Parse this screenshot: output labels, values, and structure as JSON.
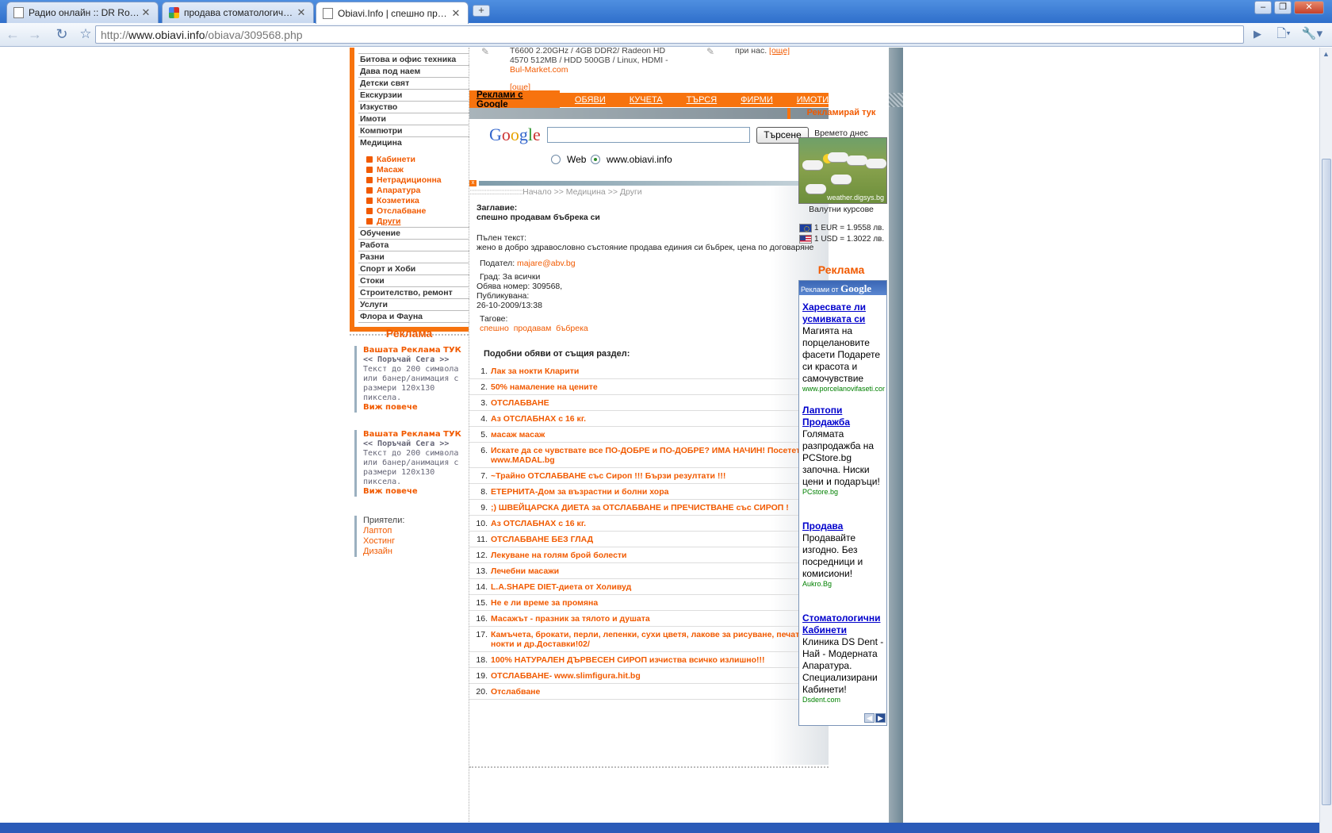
{
  "browser": {
    "tabs": [
      {
        "title": "Радио онлайн :: DR Rock ...",
        "icon": "page-icon",
        "active": false
      },
      {
        "title": "продава стоматологичен ...",
        "icon": "google-icon",
        "active": false
      },
      {
        "title": "Obiavi.Info | спешно прод...",
        "icon": "page-icon",
        "active": true
      }
    ],
    "new_tab_glyph": "+",
    "url_prefix": "http://",
    "url_host": "www.obiavi.info",
    "url_path": "/obiava/309568.php"
  },
  "top_products": {
    "item_text": "T6600 2.20GHz / 4GB DDR2/ Radeon HD 4570 512MB / HDD 500GB / Linux, HDMI - ",
    "item_link": "Bul-Market.com",
    "item_more": "[още]",
    "right_text": "при нас.",
    "right_more": "[още]"
  },
  "sidebar": {
    "categories_top": [
      "Битова и офис техника",
      "Дава под наем",
      "Детски свят",
      "Екскурзии",
      "Изкуство",
      "Имоти",
      "Компютри",
      "Медицина"
    ],
    "subcategories": [
      "Кабинети",
      "Масаж",
      "Нетрадиционна",
      "Апаратура",
      "Козметика",
      "Отслабване",
      "Други"
    ],
    "categories_bottom": [
      "Обучение",
      "Работа",
      "Разни",
      "Спорт и Хоби",
      "Стоки",
      "Строителство, ремонт",
      "Услуги",
      "Флора и Фауна"
    ],
    "promo_heading": "Реклама",
    "promos": [
      {
        "title": "Вашата Реклама ТУК",
        "order": "<< Поръчай Сега >>",
        "body": "Текст до 200 символа или банер/анимация с размери 120x130 пиксела.",
        "more": "Виж повече"
      },
      {
        "title": "Вашата Реклама ТУК",
        "order": "<< Поръчай Сега >>",
        "body": "Текст до 200 символа или банер/анимация с размери 120x130 пиксела.",
        "more": "Виж повече"
      }
    ],
    "friends_label": "Приятели:",
    "friends": [
      "Лаптоп",
      "Хостинг",
      "Дизайн"
    ]
  },
  "menu": {
    "brand": "Реклами с Google",
    "items": [
      "ОБЯВИ",
      "КУЧЕТА",
      "ТЪРСЯ",
      "ФИРМИ",
      "ИМОТИ"
    ]
  },
  "search": {
    "logo": "Google",
    "button": "Търсене",
    "query": "",
    "options": [
      {
        "label": "Web",
        "checked": false
      },
      {
        "label": "www.obiavi.info",
        "checked": true
      }
    ]
  },
  "breadcrumb": {
    "dots": ":::::::::::::::::::::::::::::::::::",
    "text": "Начало >> Медицина >> Други"
  },
  "ad": {
    "title_label": "Заглавие:",
    "title": "спешно продавам бъбрека си",
    "fulltext_label": "Пълен текст:",
    "fulltext": "жено в добро здравословно състояние продава единия си бъбрек, цена по договаряне",
    "poster_label": "Подател:",
    "poster": "majare@abv.bg",
    "city_label": "Град:",
    "city": "За всички",
    "number_label": "Обява номер:",
    "number": "309568,",
    "published_label": "Публикувана:",
    "published": "26-10-2009/13:38",
    "tags_label": "Тагове:",
    "tags": [
      "спешно",
      "продавам",
      "бъбрека"
    ]
  },
  "similar": {
    "title": "Подобни обяви от същия раздел:",
    "items": [
      "Лак за нокти Кларити",
      "50% намаление на цените",
      "ОТСЛАБВАНЕ",
      "Аз ОТСЛАБНАХ с 16 кг.",
      "масаж масаж",
      "Искате да се чувствате все ПО-ДОБРЕ и ПО-ДОБРЕ? ИМА НАЧИН! Посетете: www.MADAL.bg",
      "~Трайно ОТСЛАБВАНЕ със Сироп !!! Бързи резултати !!!",
      "ЕТЕРНИТА-Дом за възрастни и болни хора",
      ";) ШВЕЙЦАРСКА ДИЕТА за ОТСЛАБВАНЕ и ПРЕЧИСТВАНЕ със СИРОП !",
      "Аз ОТСЛАБНАХ с 16 кг.",
      "ОТСЛАБВАНЕ БЕЗ ГЛАД",
      "Лекуване на голям брой болести",
      "Лечебни масажи",
      "L.A.SHAPE DIET-диета от Холивуд",
      "Не е ли време за промяна",
      "Масажът - празник за тялото и душата",
      "Камъчета, брокати, перли, лепенки, сухи цветя, лакове за рисуване, печати за нокти и др.Доставки!02/",
      "100% НАТУРАЛЕН ДЪРВЕСЕН СИРОП изчиства всичко излишно!!!",
      "ОТСЛАБВАНЕ- www.slimfigura.hit.bg",
      "Отслабване"
    ]
  },
  "right": {
    "advertise_here": "Рекламирай тук",
    "weather_label": "Времето днес",
    "weather_watermark": "weather.digsys.bg",
    "currency_label": "Валутни курсове",
    "rates": [
      {
        "flag": "eu-flag",
        "text": "1 EUR = 1.9558 лв."
      },
      {
        "flag": "us-flag",
        "text": "1 USD = 1.3022 лв."
      }
    ],
    "ads_heading": "Реклама",
    "ads_header_prefix": "Реклами от",
    "ads_header_brand": "Google",
    "google_ads": [
      {
        "title": "Харесвате ли усмивката си",
        "body": "Магията на порцелановите фасети Подарете си красота и самочувствие",
        "url": "www.porcelanovifaseti.com"
      },
      {
        "title": "Лаптопи Продажба",
        "body": "Голямата разпродажба на PCStore.bg започна. Ниски цени и подаръци!",
        "url": "PCstore.bg"
      },
      {
        "title": "Продава",
        "body": "Продавайте изгодно. Без посредници и комисиони!",
        "url": "Aukro.Bg"
      },
      {
        "title": "Стоматологични Кабинети",
        "body": "Клиника DS Dent - Най - Модерната Апаратура. Специализирани Кабинети!",
        "url": "Dsdent.com"
      }
    ]
  }
}
